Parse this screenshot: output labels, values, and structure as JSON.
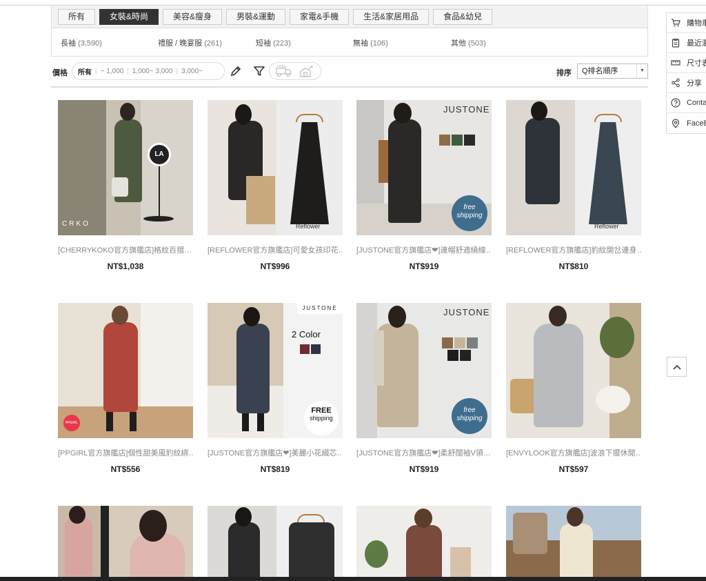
{
  "categories": {
    "tabs": [
      "所有",
      "女裝&時尚",
      "美容&瘦身",
      "男裝&運動",
      "家電&手機",
      "生活&家居用品",
      "食品&幼兒"
    ],
    "active_index": 1,
    "subcategories": [
      {
        "label": "長袖",
        "count": "(3,590)"
      },
      {
        "label": "禮服 / 晚宴服",
        "count": "(261)"
      },
      {
        "label": "短袖",
        "count": "(223)"
      },
      {
        "label": "無袖",
        "count": "(106)"
      },
      {
        "label": "其他",
        "count": "(503)"
      }
    ]
  },
  "filters": {
    "price_label": "價格",
    "price_options": [
      "所有",
      "~ 1,000",
      "1,000~ 3,000",
      "3,000~"
    ],
    "selected_price": "所有",
    "icons": [
      "pencil-icon",
      "funnel-icon",
      "free-shipping-truck-icon",
      "delivery-icon"
    ],
    "sort_label": "排序",
    "sort_value": "Q排名順序"
  },
  "products": [
    {
      "name": "[CHERRYKOKO官方旗艦店]格紋百摺…",
      "price": "NT$1,038",
      "brand_mark": "CRKO"
    },
    {
      "name": "[REFLOWER官方旗艦店]可愛女孩印花…",
      "price": "NT$996",
      "brand_mark": "Reflower"
    },
    {
      "name": "[JUSTONE官方旗艦店❤]連帽舒適繞線…",
      "price": "NT$919",
      "brand_mark": "JUSTONE",
      "badge": "free shipping"
    },
    {
      "name": "[REFLOWER官方旗艦店]豹紋開岔連身…",
      "price": "NT$810",
      "brand_mark": "Reflower"
    },
    {
      "name": "[PPGIRL官方旗艦店]個性甜美風豹紋綁…",
      "price": "NT$556",
      "brand_mark": "PPGIRL"
    },
    {
      "name": "[JUSTONE官方旗艦店❤]美麗小花綴芯…",
      "price": "NT$819",
      "brand_mark": "JUSTONE",
      "badge_top": "FREE",
      "badge_bottom": "shipping",
      "color_text": "2 Color"
    },
    {
      "name": "[JUSTONE官方旗艦店❤]柔舒闊袖V領…",
      "price": "NT$919",
      "brand_mark": "JUSTONE",
      "badge": "free shipping"
    },
    {
      "name": "[ENVYLOOK官方旗艦店]波浪下擺休閒…",
      "price": "NT$597"
    },
    {
      "name": "",
      "price": ""
    },
    {
      "name": "",
      "price": ""
    },
    {
      "name": "",
      "price": ""
    },
    {
      "name": "",
      "price": ""
    }
  ],
  "sidebar": {
    "items": [
      {
        "label": "購物車",
        "icon": "cart-icon"
      },
      {
        "label": "最近瀏",
        "icon": "clipboard-icon"
      },
      {
        "label": "尺寸表",
        "icon": "ruler-icon"
      },
      {
        "label": "分享",
        "icon": "share-icon"
      },
      {
        "label": "Contact",
        "icon": "question-icon"
      },
      {
        "label": "FaceBook",
        "icon": "location-pin-icon"
      }
    ]
  },
  "colors": {
    "active_tab": "#333333",
    "badge_blue": "#3f6d8e",
    "ppgirl_badge": "#e8374a"
  }
}
